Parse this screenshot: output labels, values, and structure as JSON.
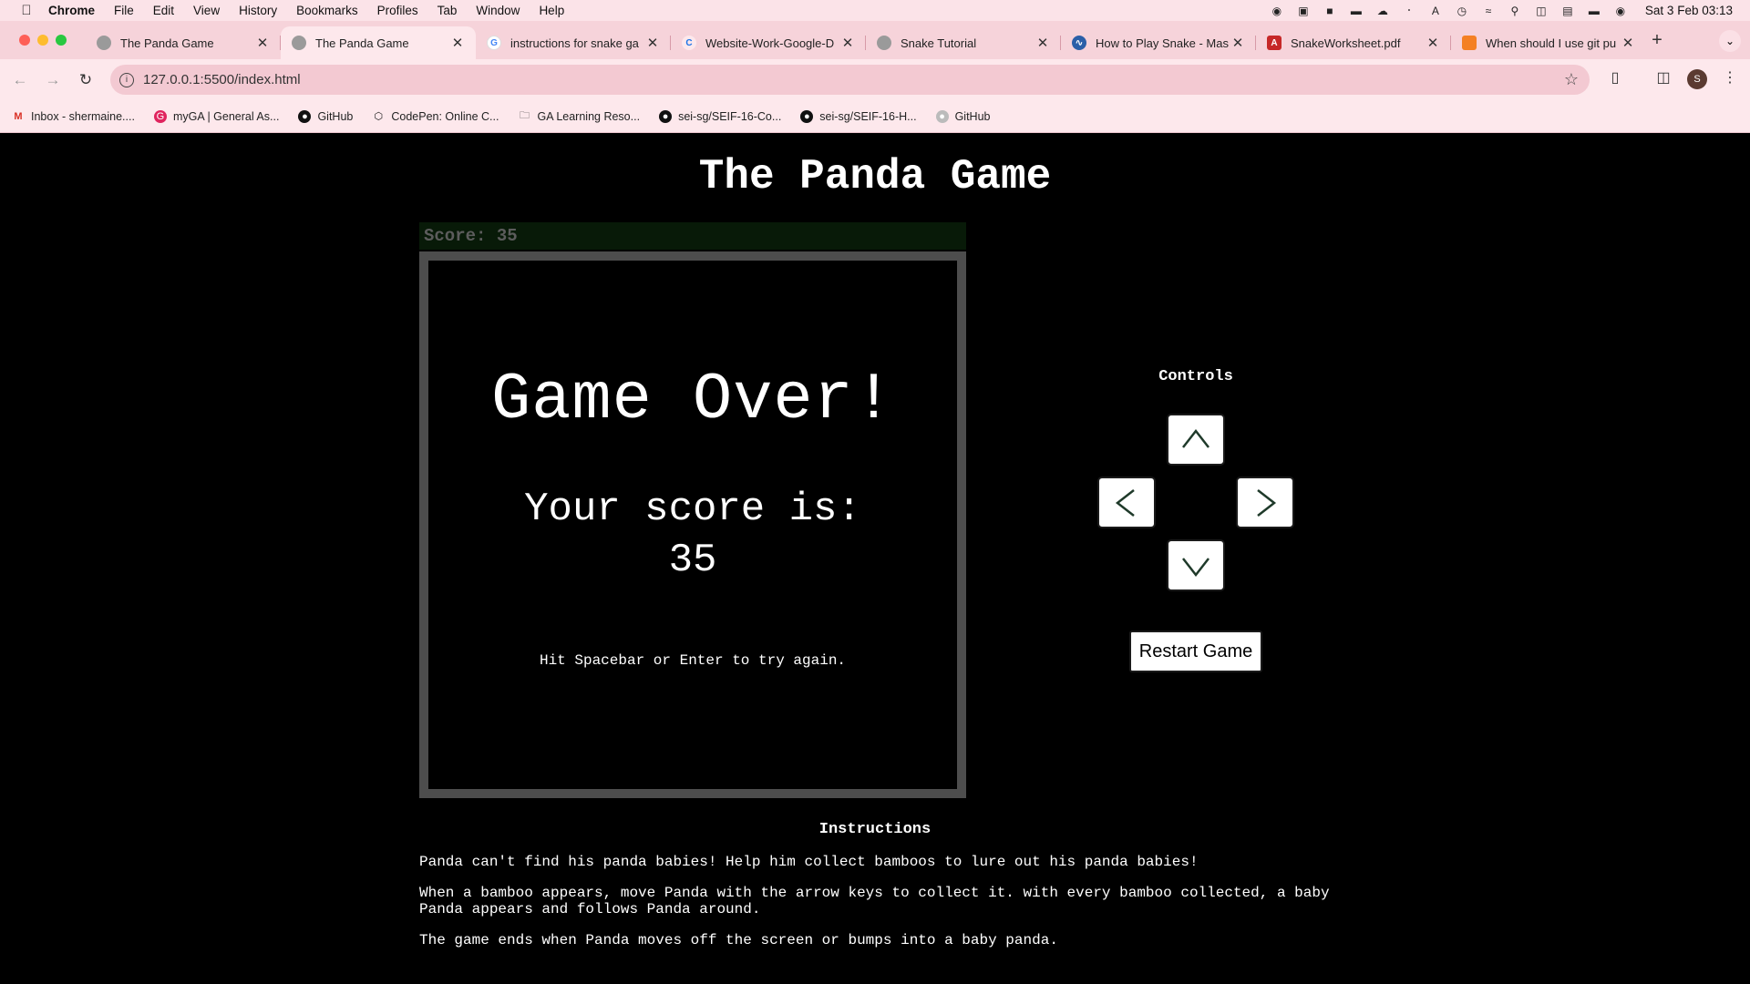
{
  "menubar": {
    "app": "Chrome",
    "items": [
      "File",
      "Edit",
      "View",
      "History",
      "Bookmarks",
      "Profiles",
      "Tab",
      "Window",
      "Help"
    ],
    "clock": "Sat 3 Feb  03:13"
  },
  "tabs": [
    {
      "title": "The Panda Game",
      "favicon": "globe-icon",
      "active": false
    },
    {
      "title": "The Panda Game",
      "favicon": "globe-icon",
      "active": true
    },
    {
      "title": "instructions for snake ga",
      "favicon": "google-icon",
      "active": false
    },
    {
      "title": "Website-Work-Google-D",
      "favicon": "codepen-icon",
      "active": false
    },
    {
      "title": "Snake Tutorial",
      "favicon": "globe-icon",
      "active": false
    },
    {
      "title": "How to Play Snake - Mas",
      "favicon": "snake-icon",
      "active": false
    },
    {
      "title": "SnakeWorksheet.pdf",
      "favicon": "pdf-icon",
      "active": false
    },
    {
      "title": "When should I use git pu",
      "favicon": "stackoverflow-icon",
      "active": false
    }
  ],
  "address": {
    "url": "127.0.0.1:5500/index.html"
  },
  "profile": {
    "initial": "S"
  },
  "bookmarks": [
    {
      "label": "Inbox - shermaine....",
      "icon": "gmail-icon"
    },
    {
      "label": "myGA | General As...",
      "icon": "ga-icon"
    },
    {
      "label": "GitHub",
      "icon": "github-icon"
    },
    {
      "label": "CodePen: Online C...",
      "icon": "codepen-icon"
    },
    {
      "label": "GA Learning Reso...",
      "icon": "folder-icon"
    },
    {
      "label": "sei-sg/SEIF-16-Co...",
      "icon": "github-icon"
    },
    {
      "label": "sei-sg/SEIF-16-H...",
      "icon": "github-icon"
    },
    {
      "label": "GitHub",
      "icon": "github-icon"
    }
  ],
  "game": {
    "title": "The Panda Game",
    "score_label": "Score: 35",
    "over_title": "Game Over!",
    "over_score_line1": "Your score is:",
    "over_score_value": "35",
    "over_hint": "Hit Spacebar or Enter to try again.",
    "controls_label": "Controls",
    "restart_label": "Restart Game"
  },
  "instructions": {
    "title": "Instructions",
    "paragraphs": [
      "Panda can't find his panda babies! Help him collect bamboos to lure out his panda babies!",
      "When a bamboo appears, move Panda with the arrow keys to collect it. with every bamboo collected, a baby Panda appears and follows Panda around.",
      "The game ends when Panda moves off the screen or bumps into a baby panda."
    ]
  },
  "colors": {
    "page_bg": "#000000",
    "board_border": "#4d4d4d",
    "chrome_pink": "#fde8ec",
    "arrow_stroke": "#1f3a2a"
  }
}
